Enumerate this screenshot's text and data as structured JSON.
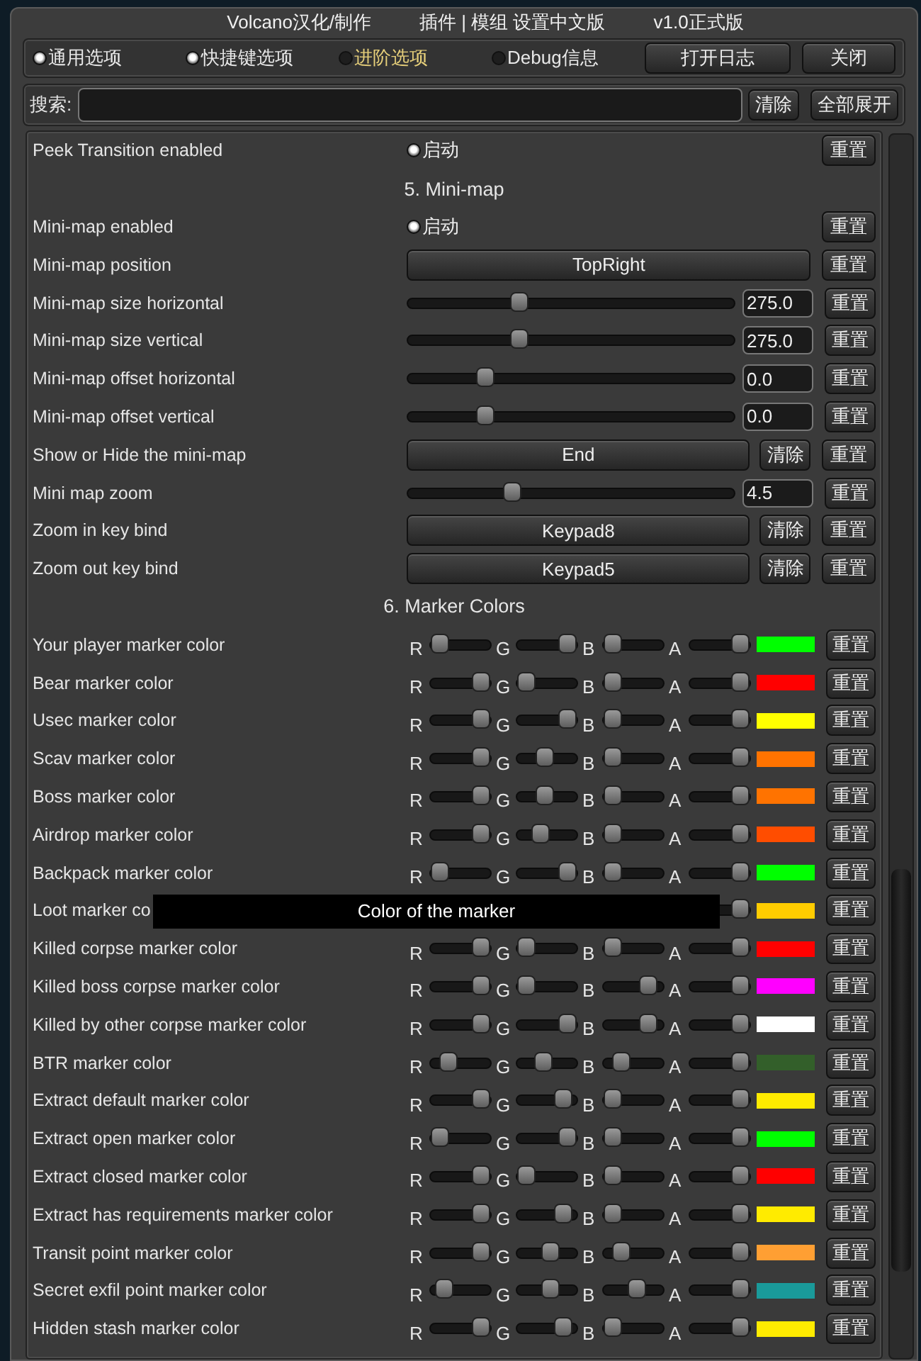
{
  "window": {
    "title_parts": [
      "Volcano汉化/制作",
      "插件 | 模组  设置中文版",
      "v1.0正式版"
    ]
  },
  "tabs": [
    {
      "label": "通用选项",
      "on": true,
      "selected": false
    },
    {
      "label": "快捷键选项",
      "on": true,
      "selected": false
    },
    {
      "label": "进阶选项",
      "on": false,
      "selected": true
    },
    {
      "label": "Debug信息",
      "on": false,
      "selected": false
    }
  ],
  "toolbar_buttons": [
    "打开日志",
    "关闭"
  ],
  "search": {
    "label": "搜索:",
    "clear": "清除",
    "expand_all": "全部展开"
  },
  "settings": [
    {
      "kind": "toggle",
      "label": "Peek Transition enabled",
      "option": "启动",
      "on": true,
      "reset": "重置"
    },
    {
      "kind": "header",
      "text": "5. Mini-map"
    },
    {
      "kind": "toggle",
      "label": "Mini-map enabled",
      "option": "启动",
      "on": true,
      "reset": "重置"
    },
    {
      "kind": "dropdown",
      "label": "Mini-map position",
      "value": "TopRight",
      "reset": "重置"
    },
    {
      "kind": "slider",
      "label": "Mini-map size horizontal",
      "level": 0.33,
      "value": "275.0",
      "reset": "重置"
    },
    {
      "kind": "slider",
      "label": "Mini-map size vertical",
      "level": 0.33,
      "value": "275.0",
      "reset": "重置"
    },
    {
      "kind": "slider",
      "label": "Mini-map offset horizontal",
      "level": 0.22,
      "value": "0.0",
      "reset": "重置"
    },
    {
      "kind": "slider",
      "label": "Mini-map offset vertical",
      "level": 0.22,
      "value": "0.0",
      "reset": "重置"
    },
    {
      "kind": "keybind",
      "label": "Show or Hide the mini-map",
      "key": "End",
      "clear": "清除",
      "reset": "重置"
    },
    {
      "kind": "slider",
      "label": "Mini map zoom",
      "level": 0.31,
      "value": "4.5",
      "reset": "重置"
    },
    {
      "kind": "keybind",
      "label": "Zoom in key bind",
      "key": "Keypad8",
      "clear": "清除",
      "reset": "重置"
    },
    {
      "kind": "keybind",
      "label": "Zoom out key bind",
      "key": "Keypad5",
      "clear": "清除",
      "reset": "重置"
    },
    {
      "kind": "header",
      "text": "6. Marker Colors"
    },
    {
      "kind": "color",
      "label": "Your player marker color",
      "channels": [
        {
          "label": "R",
          "level": 0
        },
        {
          "label": "G",
          "level": 1
        },
        {
          "label": "B",
          "level": 0
        },
        {
          "label": "A",
          "level": 1
        }
      ],
      "color": "#00ff00",
      "reset": "重置"
    },
    {
      "kind": "color",
      "label": "Bear marker color",
      "channels": [
        {
          "label": "R",
          "level": 1
        },
        {
          "label": "G",
          "level": 0
        },
        {
          "label": "B",
          "level": 0
        },
        {
          "label": "A",
          "level": 1
        }
      ],
      "color": "#ff0000",
      "reset": "重置"
    },
    {
      "kind": "color",
      "label": "Usec marker color",
      "channels": [
        {
          "label": "R",
          "level": 1
        },
        {
          "label": "G",
          "level": 1
        },
        {
          "label": "B",
          "level": 0
        },
        {
          "label": "A",
          "level": 1
        }
      ],
      "color": "#ffff00",
      "reset": "重置"
    },
    {
      "kind": "color",
      "label": "Scav marker color",
      "channels": [
        {
          "label": "R",
          "level": 1
        },
        {
          "label": "G",
          "level": 0.45
        },
        {
          "label": "B",
          "level": 0
        },
        {
          "label": "A",
          "level": 1
        }
      ],
      "color": "#ff7300",
      "reset": "重置"
    },
    {
      "kind": "color",
      "label": "Boss marker color",
      "channels": [
        {
          "label": "R",
          "level": 1
        },
        {
          "label": "G",
          "level": 0.45
        },
        {
          "label": "B",
          "level": 0
        },
        {
          "label": "A",
          "level": 1
        }
      ],
      "color": "#ff7300",
      "reset": "重置"
    },
    {
      "kind": "color",
      "label": "Airdrop marker color",
      "channels": [
        {
          "label": "R",
          "level": 1
        },
        {
          "label": "G",
          "level": 0.35
        },
        {
          "label": "B",
          "level": 0
        },
        {
          "label": "A",
          "level": 1
        }
      ],
      "color": "#ff4d00",
      "reset": "重置"
    },
    {
      "kind": "color",
      "label": "Backpack marker color",
      "channels": [
        {
          "label": "R",
          "level": 0
        },
        {
          "label": "G",
          "level": 1
        },
        {
          "label": "B",
          "level": 0
        },
        {
          "label": "A",
          "level": 1
        }
      ],
      "color": "#00ff00",
      "reset": "重置"
    },
    {
      "kind": "color",
      "label": "Loot marker co",
      "channels": [
        {
          "level": 1
        }
      ],
      "color": "#ffcc00",
      "reset": "重置",
      "tooltip": "Color of the marker"
    },
    {
      "kind": "color",
      "label": "Killed corpse marker color",
      "channels": [
        {
          "label": "R",
          "level": 1
        },
        {
          "label": "G",
          "level": 0
        },
        {
          "label": "B",
          "level": 0
        },
        {
          "label": "A",
          "level": 1
        }
      ],
      "color": "#ff0000",
      "reset": "重置"
    },
    {
      "kind": "color",
      "label": "Killed boss corpse marker color",
      "channels": [
        {
          "label": "R",
          "level": 1
        },
        {
          "label": "G",
          "level": 0
        },
        {
          "label": "B",
          "level": 0.85
        },
        {
          "label": "A",
          "level": 1
        }
      ],
      "color": "#ff00ff",
      "reset": "重置"
    },
    {
      "kind": "color",
      "label": "Killed by other corpse marker color",
      "channels": [
        {
          "label": "R",
          "level": 1
        },
        {
          "label": "G",
          "level": 1
        },
        {
          "label": "B",
          "level": 0.85
        },
        {
          "label": "A",
          "level": 1
        }
      ],
      "color": "#ffffff",
      "reset": "重置"
    },
    {
      "kind": "color",
      "label": "BTR marker color",
      "channels": [
        {
          "label": "R",
          "level": 0.2
        },
        {
          "label": "G",
          "level": 0.4
        },
        {
          "label": "B",
          "level": 0.2
        },
        {
          "label": "A",
          "level": 1
        }
      ],
      "color": "#335f2a",
      "reset": "重置"
    },
    {
      "kind": "color",
      "label": "Extract default marker color",
      "channels": [
        {
          "label": "R",
          "level": 1
        },
        {
          "label": "G",
          "level": 0.9
        },
        {
          "label": "B",
          "level": 0
        },
        {
          "label": "A",
          "level": 1
        }
      ],
      "color": "#ffeb00",
      "reset": "重置"
    },
    {
      "kind": "color",
      "label": "Extract open marker color",
      "channels": [
        {
          "label": "R",
          "level": 0
        },
        {
          "label": "G",
          "level": 1
        },
        {
          "label": "B",
          "level": 0
        },
        {
          "label": "A",
          "level": 1
        }
      ],
      "color": "#00ff00",
      "reset": "重置"
    },
    {
      "kind": "color",
      "label": "Extract closed marker color",
      "channels": [
        {
          "label": "R",
          "level": 1
        },
        {
          "label": "G",
          "level": 0
        },
        {
          "label": "B",
          "level": 0
        },
        {
          "label": "A",
          "level": 1
        }
      ],
      "color": "#ff0000",
      "reset": "重置"
    },
    {
      "kind": "color",
      "label": "Extract has requirements marker color",
      "channels": [
        {
          "label": "R",
          "level": 1
        },
        {
          "label": "G",
          "level": 0.9
        },
        {
          "label": "B",
          "level": 0
        },
        {
          "label": "A",
          "level": 1
        }
      ],
      "color": "#ffeb00",
      "reset": "重置"
    },
    {
      "kind": "color",
      "label": "Transit point marker color",
      "channels": [
        {
          "label": "R",
          "level": 1
        },
        {
          "label": "G",
          "level": 0.6
        },
        {
          "label": "B",
          "level": 0.2
        },
        {
          "label": "A",
          "level": 1
        }
      ],
      "color": "#ff9f33",
      "reset": "重置"
    },
    {
      "kind": "color",
      "label": "Secret exfil point marker color",
      "channels": [
        {
          "label": "R",
          "level": 0.1
        },
        {
          "label": "G",
          "level": 0.6
        },
        {
          "label": "B",
          "level": 0.6
        },
        {
          "label": "A",
          "level": 1
        }
      ],
      "color": "#1a9a9a",
      "reset": "重置"
    },
    {
      "kind": "color",
      "label": "Hidden stash marker color",
      "channels": [
        {
          "label": "R",
          "level": 1
        },
        {
          "label": "G",
          "level": 0.9
        },
        {
          "label": "B",
          "level": 0
        },
        {
          "label": "A",
          "level": 1
        }
      ],
      "color": "#ffeb00",
      "reset": "重置"
    }
  ]
}
